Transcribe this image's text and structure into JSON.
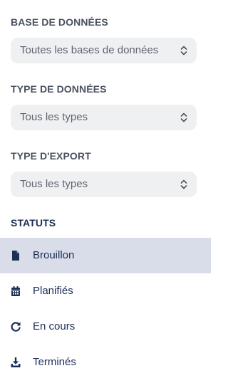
{
  "filters": {
    "database": {
      "label": "BASE DE DONNÉES",
      "value": "Toutes les bases de données"
    },
    "data_type": {
      "label": "TYPE DE DONNÉES",
      "value": "Tous les types"
    },
    "export_type": {
      "label": "TYPE D'EXPORT",
      "value": "Tous les types"
    }
  },
  "statuses": {
    "title": "STATUTS",
    "items": [
      {
        "label": "Brouillon",
        "icon": "file-icon",
        "active": true
      },
      {
        "label": "Planifiés",
        "icon": "calendar-icon",
        "active": false
      },
      {
        "label": "En cours",
        "icon": "refresh-icon",
        "active": false
      },
      {
        "label": "Terminés",
        "icon": "download-icon",
        "active": false
      }
    ]
  },
  "colors": {
    "accent": "#1c2f57",
    "active_background": "#d8dde9",
    "select_background": "#eff0f2",
    "label_text": "#4a5160"
  }
}
